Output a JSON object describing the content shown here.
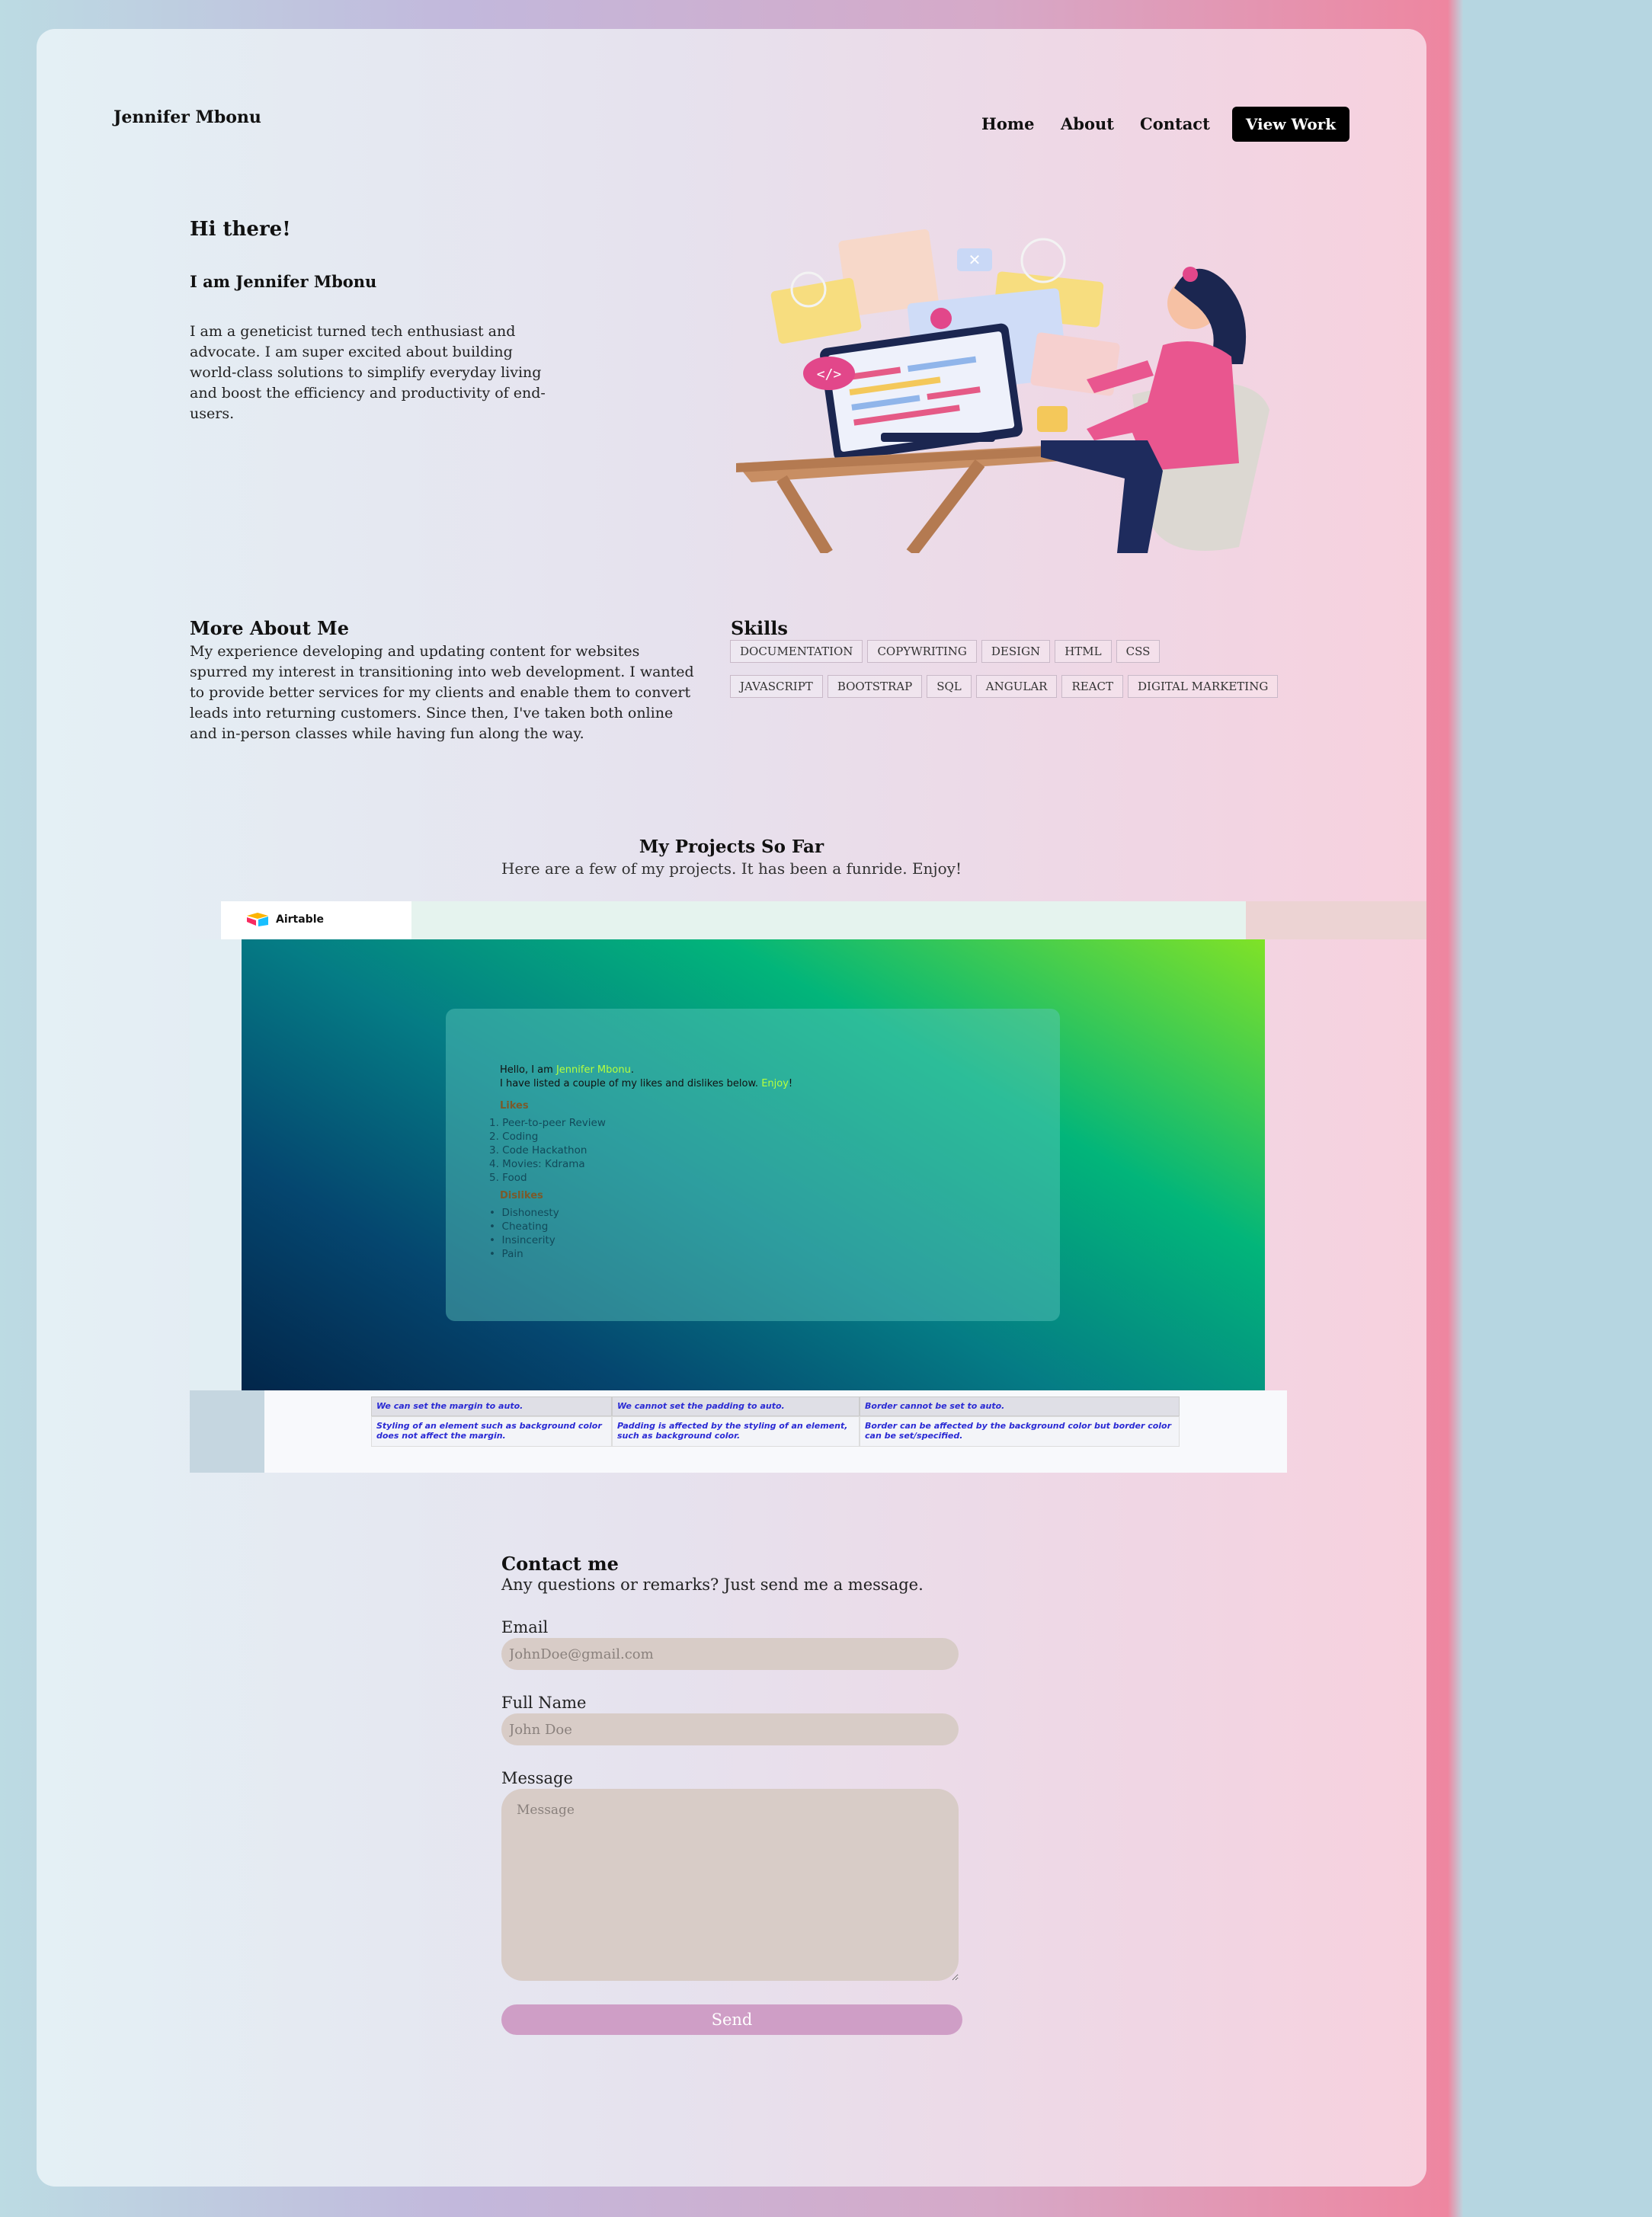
{
  "header": {
    "brand": "Jennifer Mbonu",
    "nav": [
      "Home",
      "About",
      "Contact"
    ],
    "cta": "View Work"
  },
  "hero": {
    "greeting": "Hi there!",
    "name_line": "I am Jennifer Mbonu",
    "intro": "I am a geneticist turned tech enthusiast and advocate. I am super excited about building world-class solutions to simplify everyday living and boost the efficiency and productivity of end-users."
  },
  "about": {
    "title": "More About Me",
    "text": "My experience developing and updating content for websites spurred my interest in transitioning into web development. I wanted to provide better services for my clients and enable them to convert leads into returning customers. Since then, I've taken both online and in-person classes while having fun along the way."
  },
  "skills": {
    "title": "Skills",
    "items": [
      "DOCUMENTATION",
      "COPYWRITING",
      "DESIGN",
      "HTML",
      "CSS",
      "JAVASCRIPT",
      "BOOTSTRAP",
      "SQL",
      "ANGULAR",
      "REACT",
      "DIGITAL MARKETING"
    ]
  },
  "projects": {
    "title": "My Projects So Far",
    "subtitle": "Here are a few of my projects. It has been a funride. Enjoy!",
    "airtable_label": "Airtable",
    "preview": {
      "hello_prefix": "Hello, I am ",
      "hello_name": "Jennifer Mbonu",
      "hello_suffix": ".",
      "list_prefix": "I have listed a couple of my likes and dislikes below. ",
      "list_enjoy": "Enjoy",
      "list_suffix": "!",
      "likes_title": "Likes",
      "likes": [
        "Peer-to-peer Review",
        "Coding",
        "Code Hackathon",
        "Movies: Kdrama",
        "Food"
      ],
      "dislikes_title": "Dislikes",
      "dislikes": [
        "Dishonesty",
        "Cheating",
        "Insincerity",
        "Pain"
      ]
    },
    "table": {
      "headers": [
        "We can set the margin to auto.",
        "We cannot set the padding to auto.",
        "Border cannot be set to auto."
      ],
      "cells": [
        "Styling of an element such as background color does not affect the margin.",
        "Padding is affected by the styling of an element, such as background color.",
        "Border can be affected by the background color but border color can be set/specified."
      ]
    }
  },
  "contact": {
    "title": "Contact me",
    "subtitle": "Any questions or remarks? Just send me a message.",
    "email_label": "Email",
    "email_placeholder": "JohnDoe@gmail.com",
    "name_label": "Full Name",
    "name_placeholder": "John Doe",
    "message_label": "Message",
    "message_placeholder": "Message",
    "send_label": "Send"
  },
  "colors": {
    "accent_highlight": "#b8ff3c",
    "send_button": "#cf9ec6",
    "cta_bg": "#000000"
  }
}
